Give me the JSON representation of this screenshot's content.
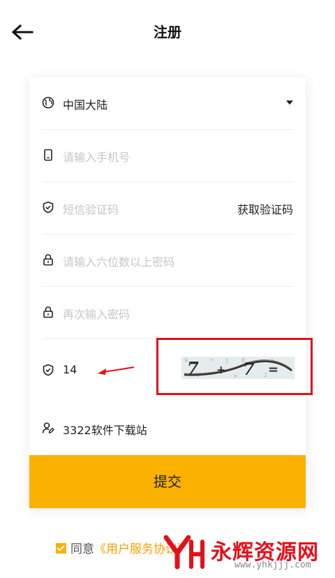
{
  "header": {
    "title": "注册",
    "back_icon": "arrow-left-icon"
  },
  "form": {
    "region": {
      "value": "中国大陆",
      "icon": "globe-icon"
    },
    "phone": {
      "placeholder": "请输入手机号",
      "icon": "phone-icon"
    },
    "sms": {
      "placeholder": "短信验证码",
      "action": "获取验证码",
      "icon": "shield-icon"
    },
    "password": {
      "placeholder": "请输入六位数以上密码",
      "icon": "lock-icon"
    },
    "confirm_password": {
      "placeholder": "再次输入密码",
      "icon": "lock-icon"
    },
    "captcha": {
      "value": "14",
      "image_text": "7 + 7 =",
      "icon": "shield-icon"
    },
    "referrer": {
      "value": "3322软件下载站",
      "icon": "user-edit-icon"
    },
    "submit_label": "提交"
  },
  "agreement": {
    "prefix": "同意",
    "link": "《用户服务协议》"
  },
  "watermark": {
    "text": "永辉资源网",
    "url": "www.yhkjjj.com"
  },
  "colors": {
    "accent": "#fbb100",
    "annotation": "#e0121b"
  }
}
